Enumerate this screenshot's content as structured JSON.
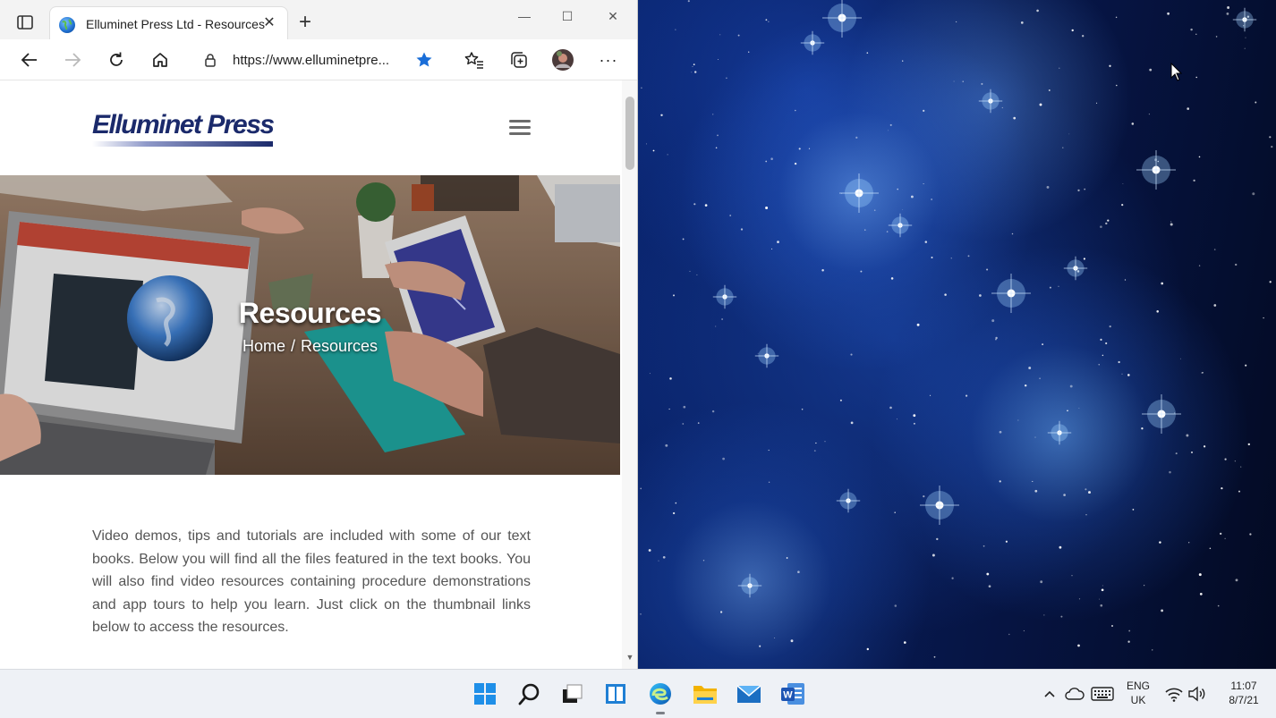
{
  "browser": {
    "tab_title": "Elluminet Press Ltd - Resources",
    "tab_close": "✕",
    "new_tab": "+",
    "window_controls": {
      "minimize": "—",
      "maximize": "☐",
      "close": "✕"
    },
    "address": "https://www.elluminetpre...",
    "more_menu": "···",
    "icons": [
      "tab-actions-icon",
      "back-icon",
      "forward-icon",
      "refresh-icon",
      "home-icon",
      "lock-icon",
      "favorite-star-icon",
      "favorites-icon",
      "collections-icon",
      "profile-avatar",
      "more-icon"
    ],
    "accent": "#1a73e8"
  },
  "page": {
    "logo": "Elluminet Press",
    "hero": {
      "title": "Resources",
      "breadcrumb": {
        "home": "Home",
        "separator": "/",
        "current": "Resources"
      }
    },
    "intro": "Video demos, tips and tutorials are included with some of our text books. Below you will find all the files featured in the text books. You will also find video resources containing procedure demonstrations and app tours to help you learn. Just click on the thumbnail links below to access the resources."
  },
  "taskbar": {
    "apps": [
      "start-icon",
      "search-icon",
      "task-view-icon",
      "widgets-icon",
      "edge-icon",
      "file-explorer-icon",
      "mail-icon",
      "word-icon"
    ],
    "tray": {
      "chevron": "^",
      "lang_top": "ENG",
      "lang_bottom": "UK",
      "time": "11:07",
      "date": "8/7/21"
    }
  }
}
